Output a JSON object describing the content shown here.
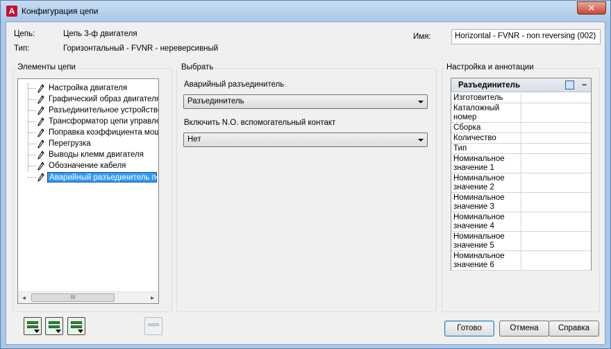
{
  "window": {
    "title": "Конфигурация цепи",
    "close_glyph": "✕",
    "app_icon_letter": "A"
  },
  "info": {
    "circuit_label": "Цепь:",
    "circuit_value": "Цепь 3-ф двигателя",
    "type_label": "Тип:",
    "type_value": "Горизонтальный - FVNR - нереверсивный",
    "name_label": "Имя:",
    "name_value": "Horizontal - FVNR - non reversing (002)"
  },
  "elements_panel": {
    "title": "Элементы цепи",
    "items": [
      "Настройка двигателя",
      "Графический образ двигателя",
      "Разъединительное устройство",
      "Трансформатор цепи управления",
      "Поправка коэффициента мощности",
      "Перегрузка",
      "Выводы клемм двигателя",
      "Обозначение кабеля",
      "Аварийный разъединитель по месту"
    ],
    "selected_index": 8,
    "scroll_left_glyph": "◂",
    "scroll_right_glyph": "▸",
    "scroll_thumb_grip": "III"
  },
  "select_panel": {
    "title": "Выбрать",
    "field1_label": "Аварийный разъединитель",
    "field1_value": "Разъединитель",
    "field2_label": "Включить N.O. вспомогательный контакт",
    "field2_value": "Нет"
  },
  "settings_panel": {
    "title": "Настройка и аннотации",
    "grid_header": "Разъединитель",
    "collapse_glyph": "−",
    "rows": [
      "Изготовитель",
      "Каталожный номер",
      "Сборка",
      "Количество",
      "Тип",
      "Номинальное значение 1",
      "Номинальное значение 2",
      "Номинальное значение 3",
      "Номинальное значение 4",
      "Номинальное значение 5",
      "Номинальное значение 6"
    ]
  },
  "buttons": {
    "ok": "Готово",
    "cancel": "Отмена",
    "help": "Справка"
  },
  "toolbar_icons": [
    "insert-circuit-icon",
    "save-circuit-icon",
    "load-circuit-icon",
    "refresh-icon"
  ],
  "colors": {
    "selection": "#3399ff",
    "frame": "#a9c7e8",
    "close": "#c9462c"
  }
}
